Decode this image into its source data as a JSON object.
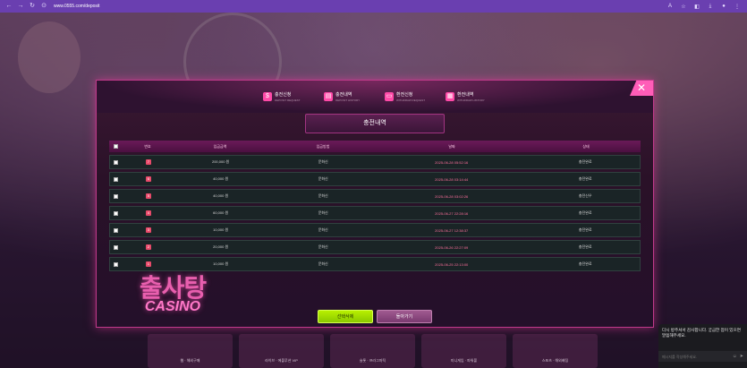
{
  "browser": {
    "url": "www.0555.com/deposit"
  },
  "background": {
    "game_cards": [
      "웹 · 해외구매",
      "라이브 · 에볼루션 VIP",
      "슬롯 · 프라그마틱",
      "미니게임 · 파워볼",
      "스포츠 · 해외배팅"
    ]
  },
  "logo": {
    "korean": "출사탕",
    "english": "CASINO"
  },
  "modal": {
    "tabs": [
      {
        "label": "충전신청",
        "sub": "DEPOSIT REQUEST"
      },
      {
        "label": "충전내역",
        "sub": "DEPOSIT HISTORY"
      },
      {
        "label": "환전신청",
        "sub": "WITHDRAW REQUEST"
      },
      {
        "label": "환전내역",
        "sub": "WITHDRAW HISTORY"
      }
    ],
    "close_label": "✕",
    "title": "충전내역",
    "table": {
      "headers": {
        "number": "번호",
        "amount": "입금금액",
        "method": "입금방법",
        "date": "날짜",
        "status": "상태"
      },
      "rows": [
        {
          "no": "7",
          "amount": "200,000 원",
          "method": "문화신",
          "date": "2025-06-28 05:52:16",
          "status": "충전완료"
        },
        {
          "no": "6",
          "amount": "40,000 원",
          "method": "문화신",
          "date": "2025-06-28 03:14:44",
          "status": "충전완료"
        },
        {
          "no": "5",
          "amount": "40,000 원",
          "method": "문화신",
          "date": "2025-06-28 03:02:26",
          "status": "충전신우"
        },
        {
          "no": "4",
          "amount": "60,000 원",
          "method": "문화신",
          "date": "2025-06-27 22:28:16",
          "status": "충전완료"
        },
        {
          "no": "3",
          "amount": "10,000 원",
          "method": "문화신",
          "date": "2025-06-27 12:38:37",
          "status": "충전완료"
        },
        {
          "no": "2",
          "amount": "20,000 원",
          "method": "문화신",
          "date": "2025-06-26 22:27:09",
          "status": "충전완료"
        },
        {
          "no": "1",
          "amount": "10,000 원",
          "method": "문화신",
          "date": "2025-06-25 22:13:00",
          "status": "충전완료"
        }
      ]
    },
    "buttons": {
      "delete": "선택삭제",
      "back": "돌아가기"
    }
  },
  "chat": {
    "message": "다시 방주셔서 감사합니다. 궁금한 점이 있으면 말씀해주세요.",
    "input_placeholder": "메시지를 작성해주세요."
  }
}
